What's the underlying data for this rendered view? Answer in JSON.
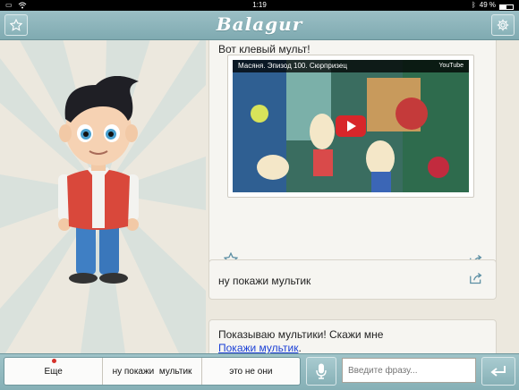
{
  "status_bar": {
    "time": "1:19",
    "battery_text": "49 %",
    "battery_level": 0.49
  },
  "header": {
    "logo": "Balagur"
  },
  "messages": [
    {
      "text": "Вот клевый мульт!",
      "video": {
        "title": "Масяня. Эпизод 100. Сюрпризец",
        "provider": "YouTube"
      }
    },
    {
      "text": "ну покажи мультик"
    },
    {
      "text": "Показываю мультики! Скажи мне",
      "link": "Покажи мультик",
      "link_suffix": "."
    }
  ],
  "suggestions": [
    "Еще",
    "ну покажи  мультик",
    "это не они"
  ],
  "input": {
    "placeholder": "Введите фразу..."
  },
  "colors": {
    "header": "#8fb6bc",
    "link": "#1a3fd6",
    "youtube_red": "#d8262a",
    "notification_dot": "#d6322b"
  },
  "icons": [
    "wifi-icon",
    "bluetooth-icon",
    "star-icon",
    "gear-icon",
    "share-icon",
    "play-icon",
    "mic-icon",
    "enter-icon"
  ]
}
